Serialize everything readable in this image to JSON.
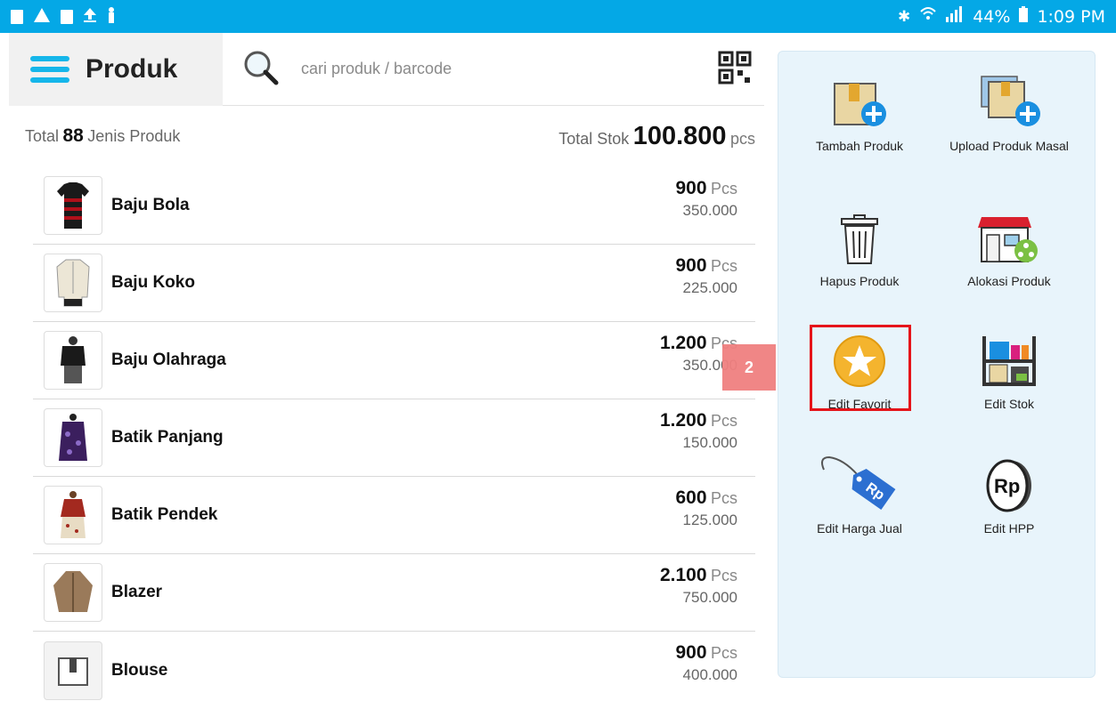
{
  "status_bar": {
    "battery": "44%",
    "time": "1:09 PM"
  },
  "header": {
    "title": "Produk",
    "search_placeholder": "cari produk / barcode"
  },
  "totals": {
    "left_prefix": "Total",
    "product_count": "88",
    "left_suffix": "Jenis Produk",
    "stock_prefix": "Total Stok",
    "stock_value": "100.800",
    "stock_unit": "pcs"
  },
  "products": [
    {
      "name": "Baju Bola",
      "qty": "900",
      "unit": "Pcs",
      "price": "350.000"
    },
    {
      "name": "Baju Koko",
      "qty": "900",
      "unit": "Pcs",
      "price": "225.000"
    },
    {
      "name": "Baju Olahraga",
      "qty": "1.200",
      "unit": "Pcs",
      "price": "350.000"
    },
    {
      "name": "Batik Panjang",
      "qty": "1.200",
      "unit": "Pcs",
      "price": "150.000"
    },
    {
      "name": "Batik Pendek",
      "qty": "600",
      "unit": "Pcs",
      "price": "125.000"
    },
    {
      "name": "Blazer",
      "qty": "2.100",
      "unit": "Pcs",
      "price": "750.000"
    },
    {
      "name": "Blouse",
      "qty": "900",
      "unit": "Pcs",
      "price": "400.000"
    }
  ],
  "menu": {
    "tambah_produk": "Tambah Produk",
    "upload_produk_masal": "Upload Produk Masal",
    "hapus_produk": "Hapus Produk",
    "alokasi_produk": "Alokasi Produk",
    "edit_favorit": "Edit Favorit",
    "edit_stok": "Edit Stok",
    "edit_harga_jual": "Edit Harga Jual",
    "edit_hpp": "Edit HPP"
  },
  "annotation": {
    "step": "2"
  },
  "colors": {
    "status_bar": "#04a8e6",
    "accent": "#15b6ea",
    "highlight": "#e5141a",
    "badge": "#f08080"
  }
}
